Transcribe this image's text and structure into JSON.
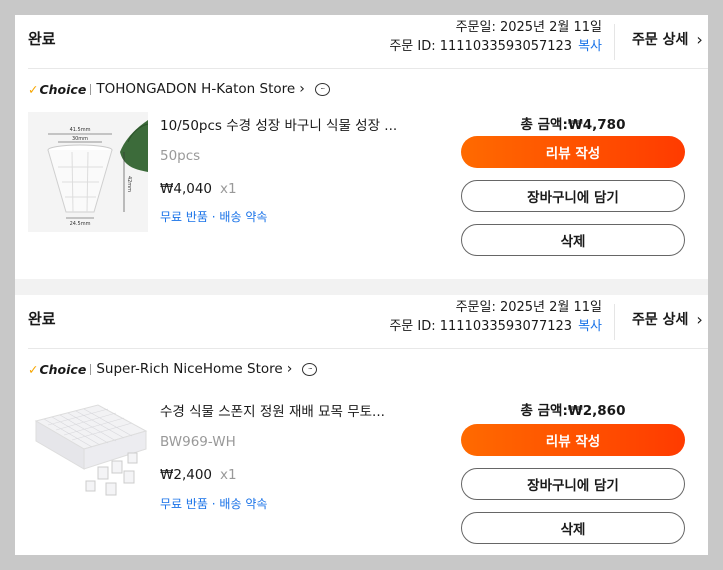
{
  "orders": [
    {
      "status": "완료",
      "order_date": "주문일: 2025년 2월 11일",
      "order_id": "주문 ID: 1111033593057123",
      "copy_label": "복사",
      "detail_label": "주문 상세",
      "choice_label": "Choice",
      "store": "TOHONGADON H-Katon Store",
      "product_name": "10/50pcs 수경 성장 바구니 식물 성장 ...",
      "variant": "50pcs",
      "price": "₩4,040",
      "qty": "x1",
      "perks": "무료 반품 · 배송 약속",
      "total": "총 금액:₩4,780",
      "review_label": "리뷰 작성",
      "cart_label": "장바구니에 담기",
      "delete_label": "삭제",
      "image_labels": {
        "top": "41.5mm",
        "mid": "30mm",
        "side": "42mm",
        "bottom": "24.5mm"
      }
    },
    {
      "status": "완료",
      "order_date": "주문일: 2025년 2월 11일",
      "order_id": "주문 ID: 1111033593077123",
      "copy_label": "복사",
      "detail_label": "주문 상세",
      "choice_label": "Choice",
      "store": "Super-Rich NiceHome Store",
      "product_name": "수경 식물 스폰지 정원 재배 묘목 무토...",
      "variant": "BW969-WH",
      "price": "₩2,400",
      "qty": "x1",
      "perks": "무료 반품 · 배송 약속",
      "total": "총 금액:₩2,860",
      "review_label": "리뷰 작성",
      "cart_label": "장바구니에 담기",
      "delete_label": "삭제"
    }
  ],
  "colors": {
    "accent_start": "#ff6a00",
    "accent_end": "#ff3b00",
    "link": "#1a73e8",
    "choice_check": "#f7a600"
  }
}
